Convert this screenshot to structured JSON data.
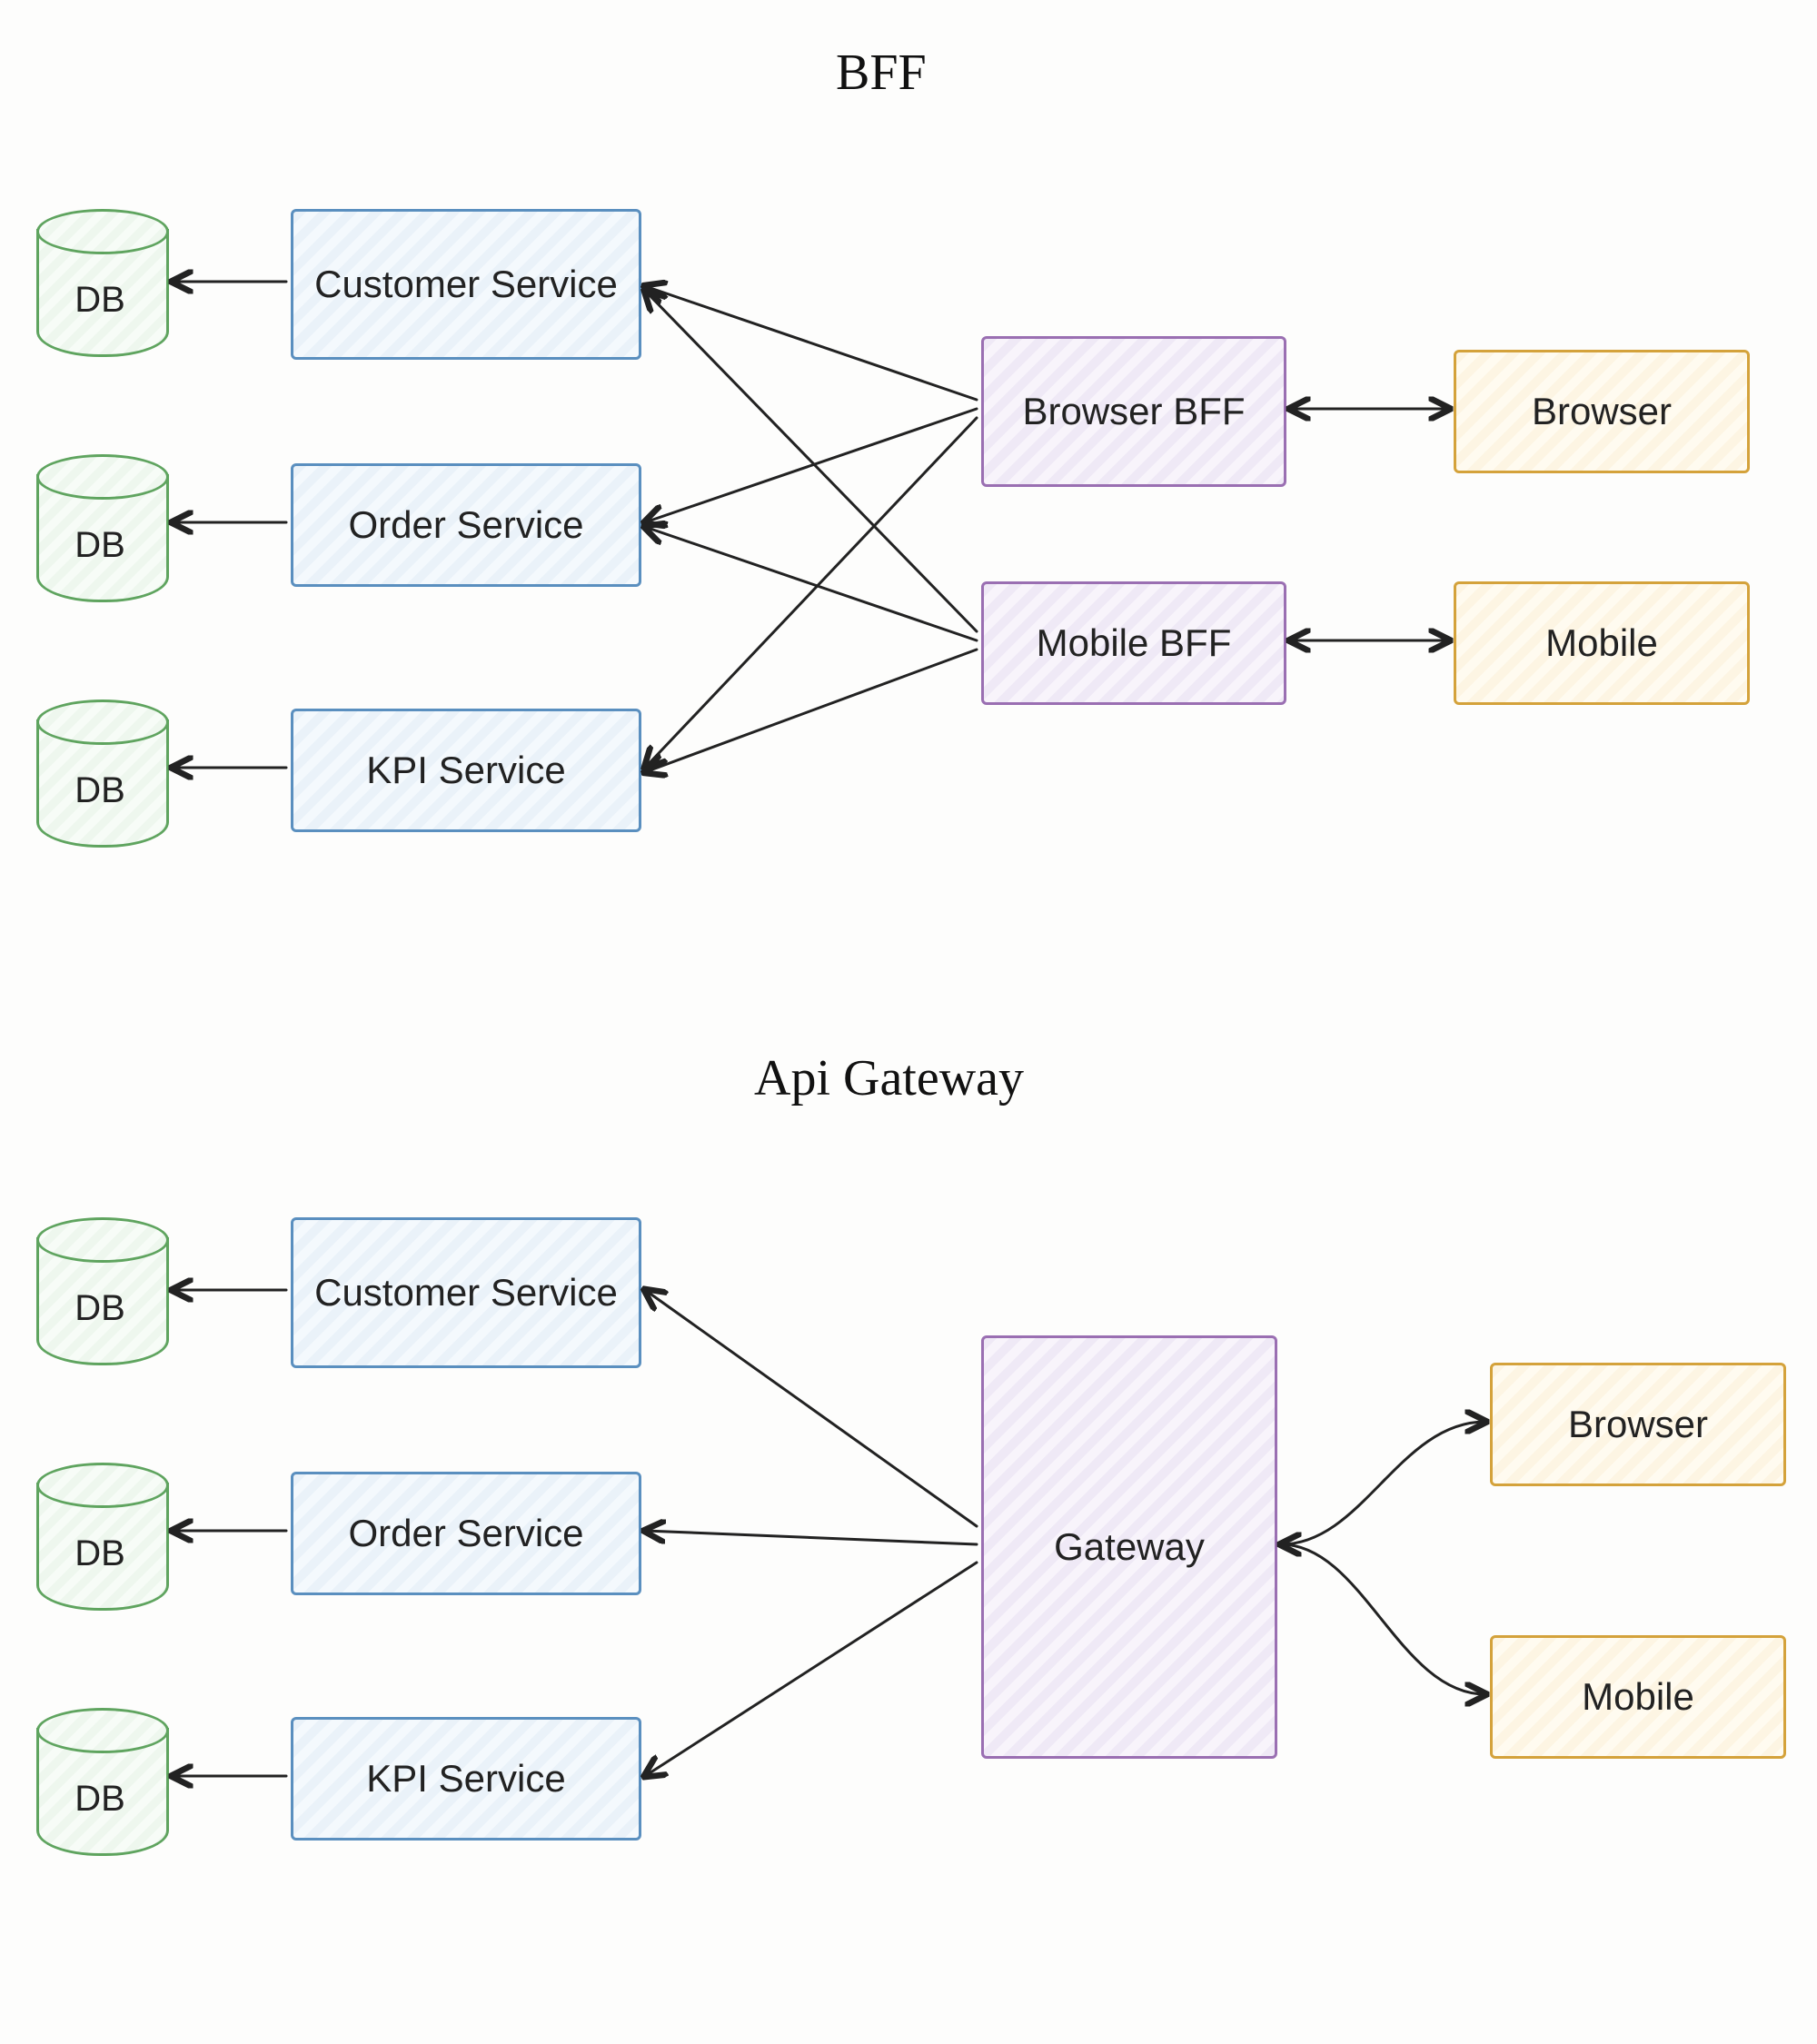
{
  "title_top": "BFF",
  "title_bottom": "Api Gateway",
  "db_label": "DB",
  "bff": {
    "services": [
      "Customer Service",
      "Order Service",
      "KPI Service"
    ],
    "bffs": [
      "Browser BFF",
      "Mobile BFF"
    ],
    "clients": [
      "Browser",
      "Mobile"
    ]
  },
  "gw": {
    "services": [
      "Customer Service",
      "Order Service",
      "KPI Service"
    ],
    "gateway": "Gateway",
    "clients": [
      "Browser",
      "Mobile"
    ]
  }
}
